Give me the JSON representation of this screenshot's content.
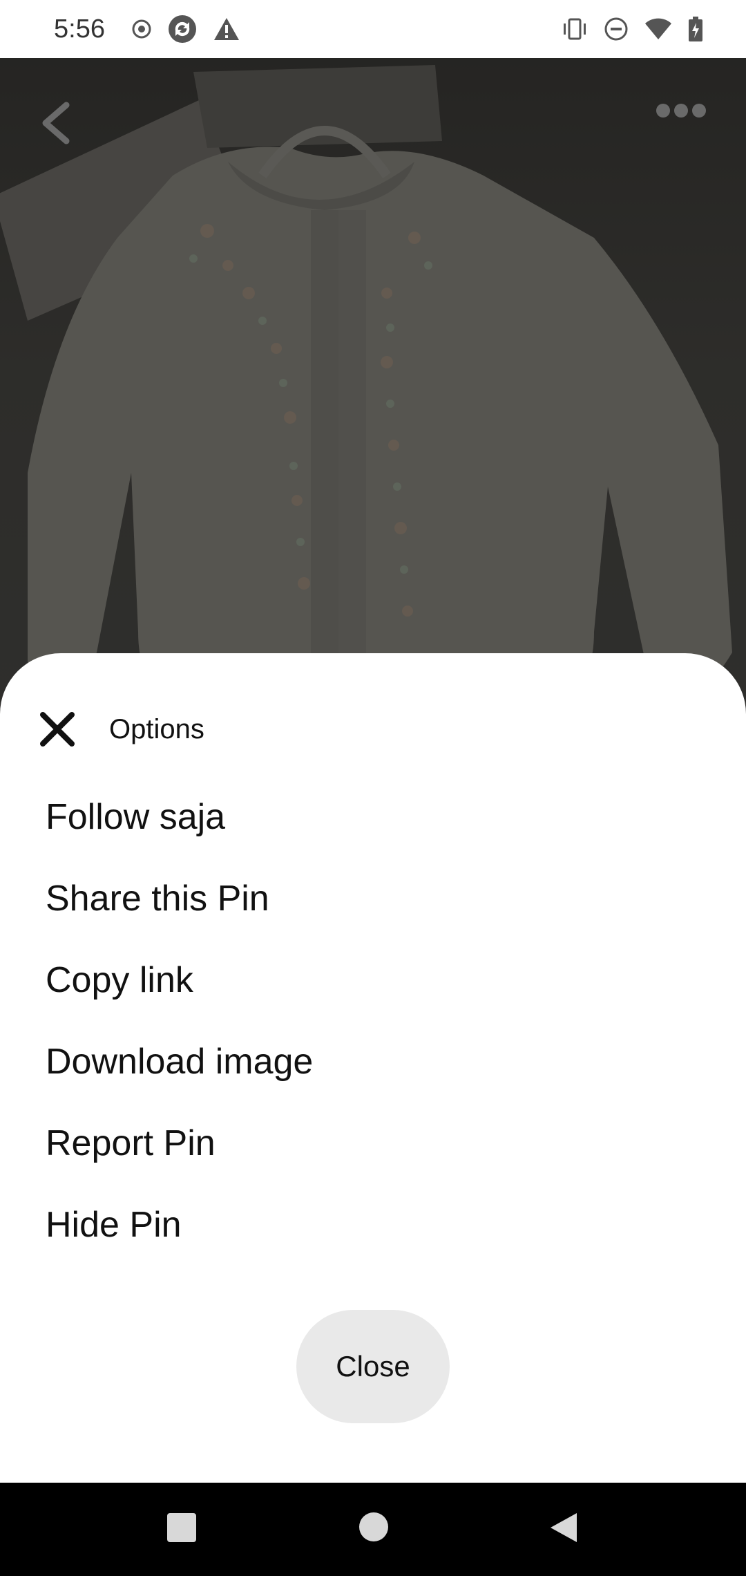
{
  "status_bar": {
    "time": "5:56",
    "left_icons": [
      "record-icon",
      "sync-icon",
      "warning-icon"
    ],
    "right_icons": [
      "vibrate-icon",
      "dnd-icon",
      "wifi-icon",
      "battery-charging-icon"
    ]
  },
  "background": {
    "image_description": "cardigan-photo",
    "back_icon": "chevron-left-icon",
    "more_icon": "more-dots-icon"
  },
  "sheet": {
    "title": "Options",
    "close_icon": "close-icon",
    "items": [
      {
        "label": "Follow saja"
      },
      {
        "label": "Share this Pin"
      },
      {
        "label": "Copy link"
      },
      {
        "label": "Download image"
      },
      {
        "label": "Report Pin"
      },
      {
        "label": "Hide Pin"
      }
    ],
    "close_button_label": "Close"
  },
  "nav_bar": {
    "buttons": [
      "recents-icon",
      "home-icon",
      "back-icon"
    ]
  },
  "colors": {
    "sheet_bg": "#ffffff",
    "text": "#111111",
    "close_button_bg": "#e9e9e9",
    "scrim": "rgba(0,0,0,0.35)",
    "nav_bar_bg": "#000000"
  }
}
